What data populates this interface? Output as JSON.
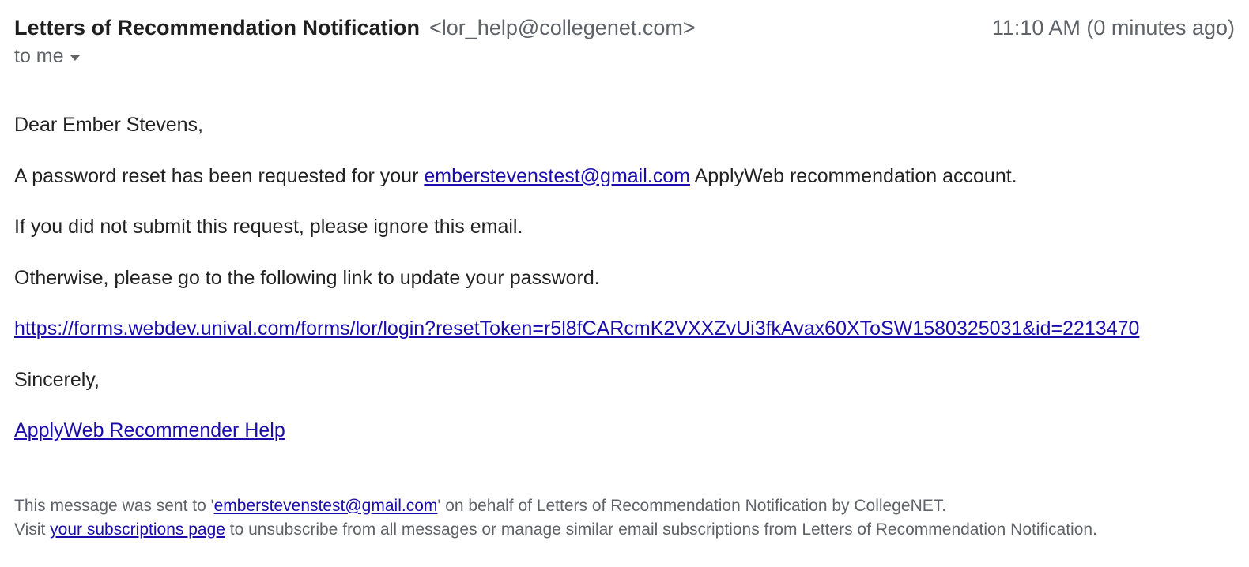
{
  "header": {
    "sender_name": "Letters of Recommendation Notification",
    "sender_email": "<lor_help@collegenet.com>",
    "timestamp": "11:10 AM (0 minutes ago)",
    "recipient_prefix": "to me"
  },
  "body": {
    "greeting": "Dear Ember Stevens,",
    "line1_pre": "A password reset has been requested for your ",
    "line1_email": "emberstevenstest@gmail.com",
    "line1_post": " ApplyWeb recommendation account.",
    "line2": "If you did not submit this request, please ignore this email.",
    "line3": "Otherwise, please go to the following link to update your password.",
    "reset_link": "https://forms.webdev.unival.com/forms/lor/login?resetToken=r5l8fCARcmK2VXXZvUi3fkAvax60XToSW1580325031&id=2213470",
    "signoff": "Sincerely,",
    "help_link_text": "ApplyWeb Recommender Help"
  },
  "footer": {
    "line1_pre": "This message was sent to '",
    "line1_email": "emberstevenstest@gmail.com",
    "line1_post": "' on behalf of Letters of Recommendation Notification by CollegeNET.",
    "line2_pre": "Visit ",
    "line2_link": "your subscriptions page",
    "line2_post": " to unsubscribe from all messages or manage similar email subscriptions from Letters of Recommendation Notification."
  }
}
